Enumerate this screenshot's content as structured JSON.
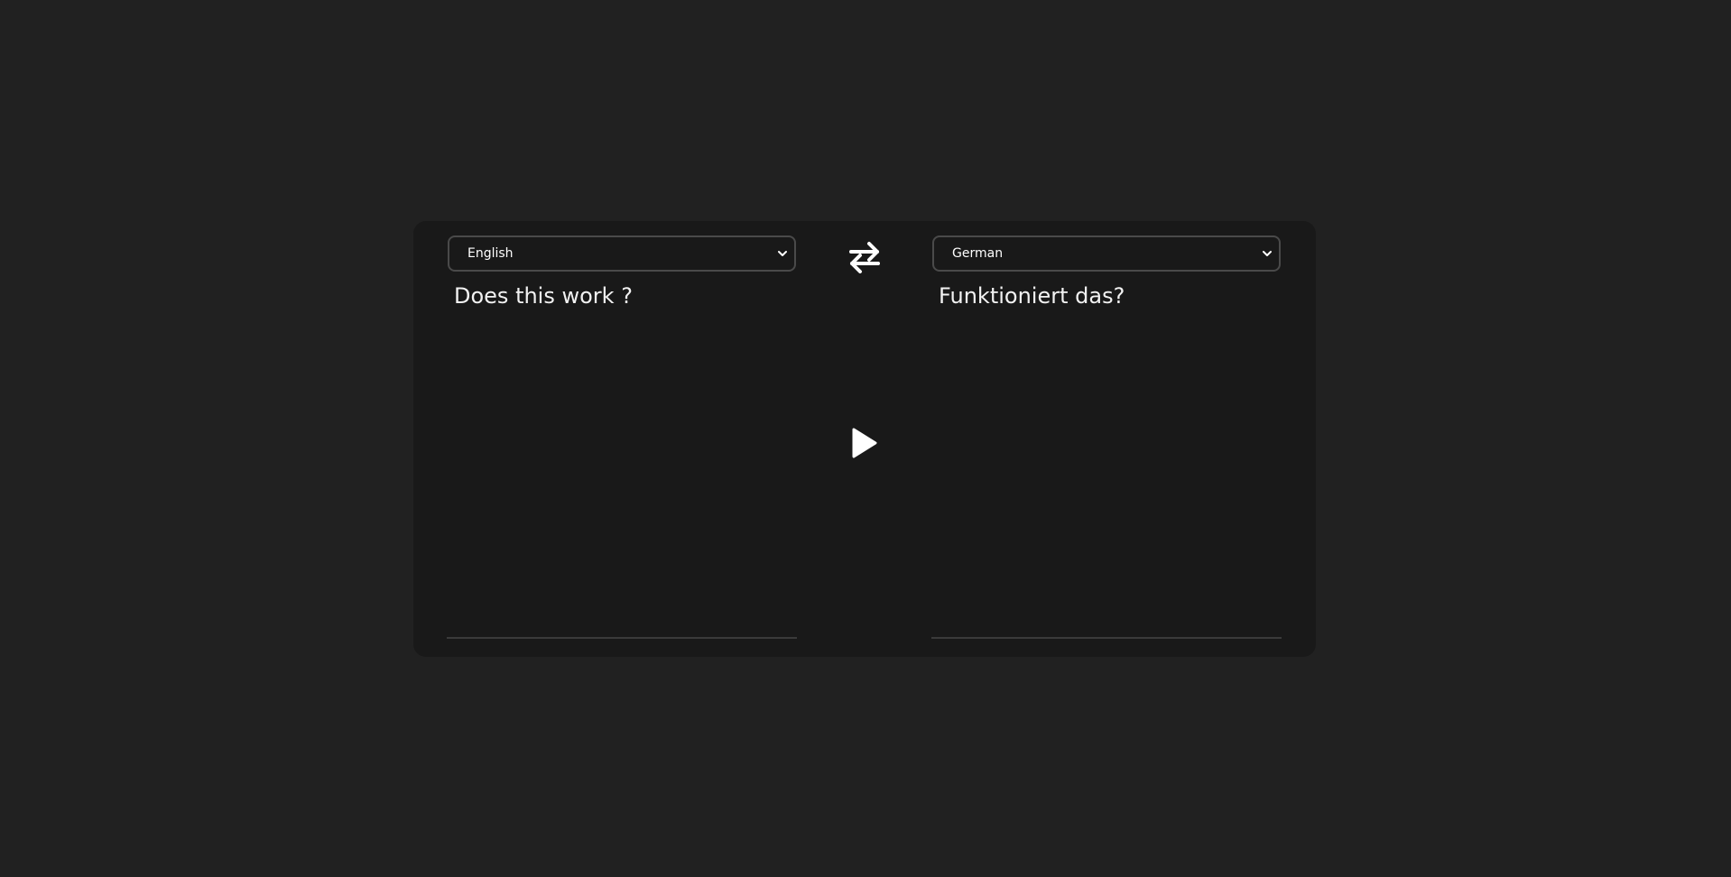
{
  "source": {
    "language": "English",
    "text": "Does this work ?"
  },
  "target": {
    "language": "German",
    "text": "Funktioniert das?"
  },
  "icons": {
    "swap": "swap-arrows-icon",
    "play": "play-icon",
    "dropdown": "chevron-down-icon"
  },
  "colors": {
    "page_background": "#212121",
    "card_background": "#191919",
    "text": "#ffffff",
    "border": "#4a4a4a"
  }
}
